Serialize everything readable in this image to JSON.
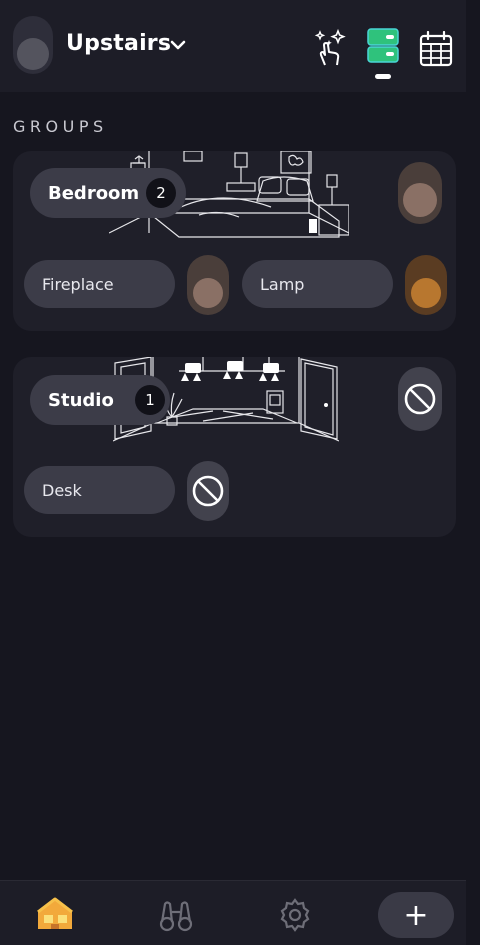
{
  "header": {
    "zone_title": "Upstairs",
    "icons": [
      "sparkle-tap-icon",
      "bridge-icon",
      "calendar-icon"
    ]
  },
  "groups_section": {
    "label": "GROUPS"
  },
  "groups": [
    {
      "name": "Bedroom",
      "light_count": "2",
      "toggle_state": "on",
      "lights": [
        {
          "name": "Fireplace",
          "toggle_state": "on",
          "color": "#8a7065"
        },
        {
          "name": "Lamp",
          "toggle_state": "on",
          "color": "#b8772f"
        }
      ]
    },
    {
      "name": "Studio",
      "light_count": "1",
      "toggle_state": "unreachable",
      "lights": [
        {
          "name": "Desk",
          "toggle_state": "unreachable"
        }
      ]
    }
  ],
  "bottom_nav": {
    "items": [
      "home-icon",
      "explore-icon",
      "settings-icon"
    ],
    "add_label": "+"
  }
}
